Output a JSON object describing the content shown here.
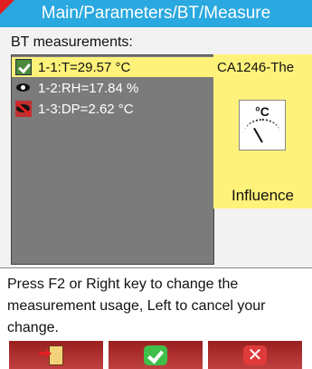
{
  "header": {
    "title": "Main/Parameters/BT/Measure"
  },
  "section": {
    "label": "BT measurements:"
  },
  "measurements": [
    {
      "label": "1-1:T=29.57 °C",
      "selected": true,
      "icon": "check-icon"
    },
    {
      "label": "1-2:RH=17.84 %",
      "selected": false,
      "icon": "eye-icon"
    },
    {
      "label": "1-3:DP=2.62 °C",
      "selected": false,
      "icon": "eye-off-icon"
    }
  ],
  "device": {
    "name": "CA1246-The",
    "gauge_unit": "°C",
    "influence_label": "Influence"
  },
  "help": {
    "text": "Press F2 or Right key to change the measurement usage, Left to cancel your change."
  },
  "softkeys": {
    "left_icon": "exit-door-icon",
    "middle_icon": "ok-check-icon",
    "right_icon": "cancel-x-icon"
  },
  "colors": {
    "title_bar": "#2aa8e0",
    "selection": "#fff27a",
    "list_background": "#7b7b7b",
    "softkey": "#b03030"
  }
}
